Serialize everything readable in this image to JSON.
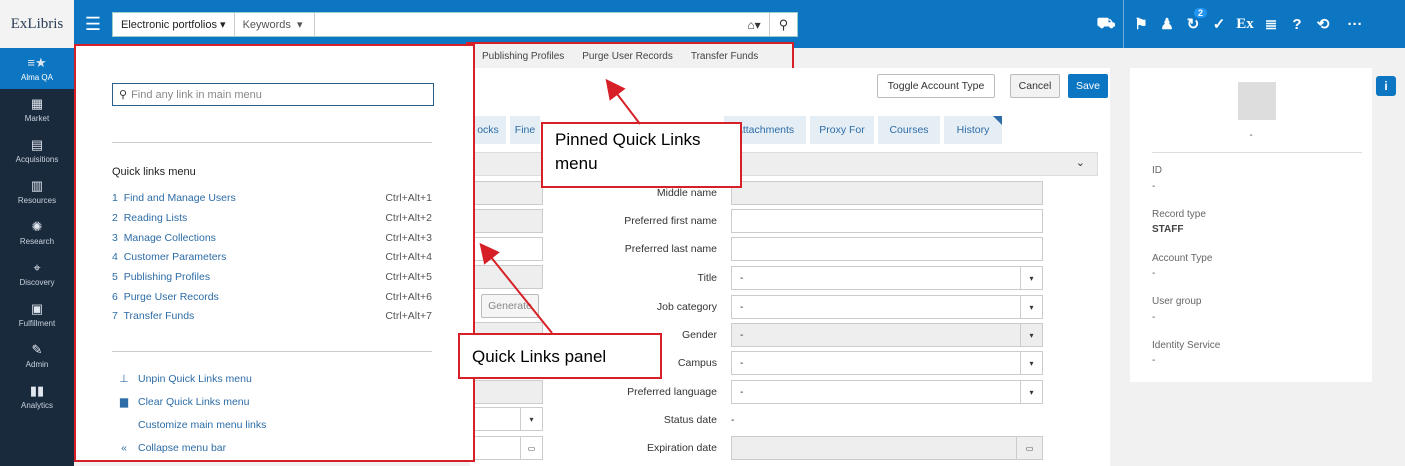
{
  "topbar": {
    "logo": "ExLibris",
    "search_scope": "Electronic portfolios",
    "search_type": "Keywords",
    "notification_count": "2",
    "accent_color": "#0d76c2"
  },
  "leftnav": {
    "items": [
      {
        "label": "Alma QA",
        "active": true
      },
      {
        "label": "Market"
      },
      {
        "label": "Acquisitions"
      },
      {
        "label": "Resources"
      },
      {
        "label": "Research"
      },
      {
        "label": "Discovery"
      },
      {
        "label": "Fulfillment"
      },
      {
        "label": "Admin"
      },
      {
        "label": "Analytics"
      }
    ]
  },
  "quicklinks": {
    "search_placeholder": "Find any link in main menu",
    "title": "Quick links menu",
    "items": [
      {
        "num": "1",
        "label": "Find and Manage Users",
        "shortcut": "Ctrl+Alt+1"
      },
      {
        "num": "2",
        "label": "Reading Lists",
        "shortcut": "Ctrl+Alt+2"
      },
      {
        "num": "3",
        "label": "Manage Collections",
        "shortcut": "Ctrl+Alt+3"
      },
      {
        "num": "4",
        "label": "Customer Parameters",
        "shortcut": "Ctrl+Alt+4"
      },
      {
        "num": "5",
        "label": "Publishing Profiles",
        "shortcut": "Ctrl+Alt+5"
      },
      {
        "num": "6",
        "label": "Purge User Records",
        "shortcut": "Ctrl+Alt+6"
      },
      {
        "num": "7",
        "label": "Transfer Funds",
        "shortcut": "Ctrl+Alt+7"
      }
    ],
    "unpin": "Unpin Quick Links menu",
    "clear": "Clear Quick Links menu",
    "customize": "Customize main menu links",
    "collapse": "Collapse menu bar"
  },
  "pinned": {
    "links": [
      "Publishing Profiles",
      "Purge User Records",
      "Transfer Funds"
    ]
  },
  "toolbar": {
    "toggle": "Toggle Account Type",
    "cancel": "Cancel",
    "save": "Save"
  },
  "tabs": [
    "ocks",
    "Fine",
    "Attachments",
    "Proxy For",
    "Courses",
    "History"
  ],
  "form": {
    "generate": "Generate",
    "labels": {
      "middle_name": "Middle name",
      "pref_first": "Preferred first name",
      "pref_last": "Preferred last name",
      "title": "Title",
      "job_category": "Job category",
      "gender": "Gender",
      "campus": "Campus",
      "pref_language": "Preferred language",
      "status_date": "Status date",
      "expiration_date": "Expiration date"
    },
    "values": {
      "title": "-",
      "job_category": "-",
      "gender": "-",
      "campus": "-",
      "pref_language": "-",
      "status_date": "-"
    }
  },
  "details": {
    "name": "-",
    "id_label": "ID",
    "id_value": "-",
    "record_type_label": "Record type",
    "record_type_value": "STAFF",
    "account_type_label": "Account Type",
    "account_type_value": "-",
    "user_group_label": "User group",
    "user_group_value": "-",
    "identity_label": "Identity Service",
    "identity_value": "-"
  },
  "callouts": {
    "pinned": "Pinned Quick Links menu",
    "panel": "Quick Links panel"
  }
}
